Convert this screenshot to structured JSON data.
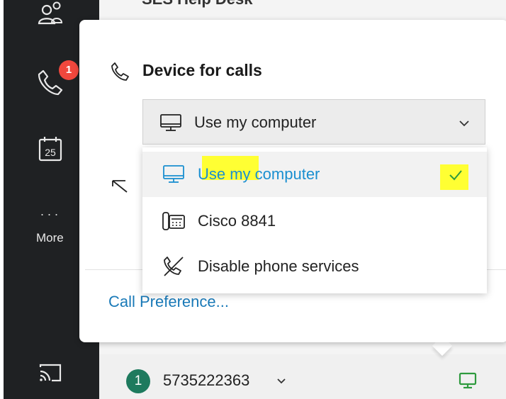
{
  "sidebar": {
    "badge_count": "1",
    "calendar_day": "25",
    "more_dots": "...",
    "more_label": "More",
    "icons": [
      "contacts-icon",
      "calls-icon",
      "calendar-icon",
      "more-icon",
      "cast-icon"
    ]
  },
  "background": {
    "top_text": "SES Help Desk"
  },
  "popover": {
    "title": "Device for calls",
    "selected_device": "Use my computer",
    "options": [
      {
        "label": "Use my computer",
        "icon": "monitor-icon",
        "selected": true
      },
      {
        "label": "Cisco 8841",
        "icon": "desk-phone-icon",
        "selected": false
      },
      {
        "label": "Disable phone services",
        "icon": "phone-off-icon",
        "selected": false
      }
    ],
    "call_preference_link": "Call Preference..."
  },
  "status_bar": {
    "line_number": "1",
    "phone_number": "5735222363"
  },
  "colors": {
    "sidebar": "#1f2123",
    "badge": "#f0473d",
    "accent_blue": "#1a8fd0",
    "link_blue": "#1a7ab8",
    "line_green": "#1e7a5e",
    "highlight_yellow": "#ffff33",
    "check_green": "#2e9a3e"
  }
}
